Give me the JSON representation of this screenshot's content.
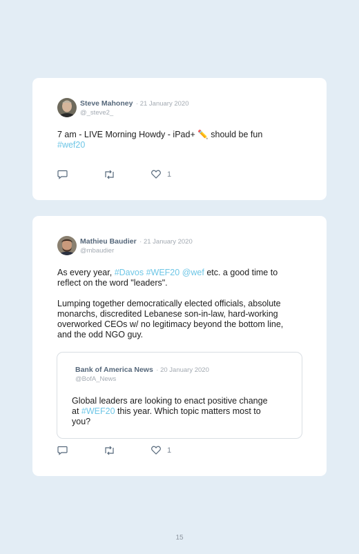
{
  "tweets": [
    {
      "author": "Steve Mahoney",
      "date": "21 January 2020",
      "handle": "@_steve2_",
      "text_line1": "7 am - LIVE Morning Howdy - iPad+ ✏️ should be fun",
      "hashtag": "#wef20",
      "like_count": "1"
    },
    {
      "author": "Mathieu Baudier",
      "date": "21 January 2020",
      "handle": "@mbaudier",
      "p1_prefix": "As every year, ",
      "p1_tag1": "#Davos",
      "p1_tag2": "#WEF20",
      "p1_tag3": "@wef",
      "p1_suffix": " etc. a good time to",
      "p1_line2": "reflect on the word \"leaders\".",
      "p2_line1": "Lumping together democratically elected officials, absolute",
      "p2_line2": "monarchs, discredited Lebanese son-in-law, hard-working",
      "p2_line3": "overworked CEOs w/ no legitimacy beyond the bottom line,",
      "p2_line4": "and the odd NGO guy.",
      "quoted": {
        "author": "Bank of America News",
        "date": "20 January 2020",
        "handle": "@BofA_News",
        "line1": "Global leaders are looking to enact positive change",
        "line2_prefix": "at ",
        "line2_tag": "#WEF20",
        "line2_suffix": " this year. Which topic matters most to",
        "line3": "you?"
      },
      "like_count": "1"
    }
  ],
  "page_number": "15",
  "colors": {
    "background": "#e3edf5",
    "link": "#6ec6e6",
    "name": "#55677a",
    "muted": "#a3aab2"
  },
  "icons": [
    "reply-icon",
    "retweet-icon",
    "like-icon"
  ]
}
